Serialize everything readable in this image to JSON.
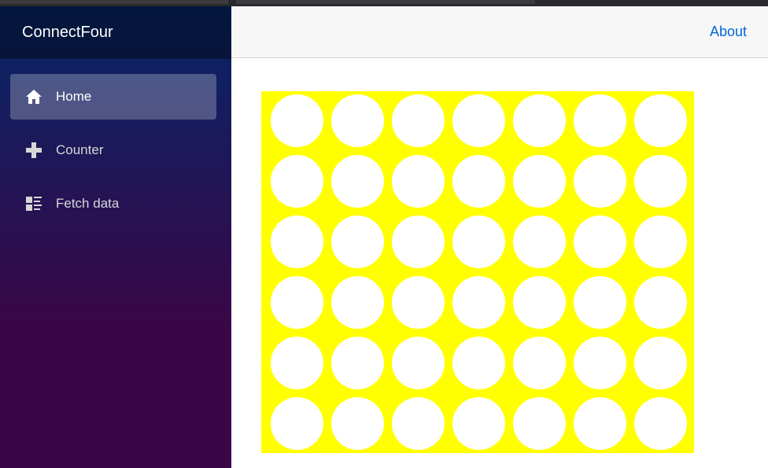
{
  "app": {
    "brand": "ConnectFour"
  },
  "sidebar": {
    "items": [
      {
        "label": "Home",
        "icon": "home-icon",
        "active": true
      },
      {
        "label": "Counter",
        "icon": "plus-icon",
        "active": false
      },
      {
        "label": "Fetch data",
        "icon": "list-rich-icon",
        "active": false
      }
    ]
  },
  "topbar": {
    "about_label": "About"
  },
  "board": {
    "rows": 6,
    "columns": 7,
    "board_color": "#ffff00",
    "empty_cell_color": "#ffffff"
  },
  "colors": {
    "accent_link": "#0366d6",
    "sidebar_gradient_top": "#052767",
    "sidebar_gradient_bottom": "#3a0647"
  }
}
